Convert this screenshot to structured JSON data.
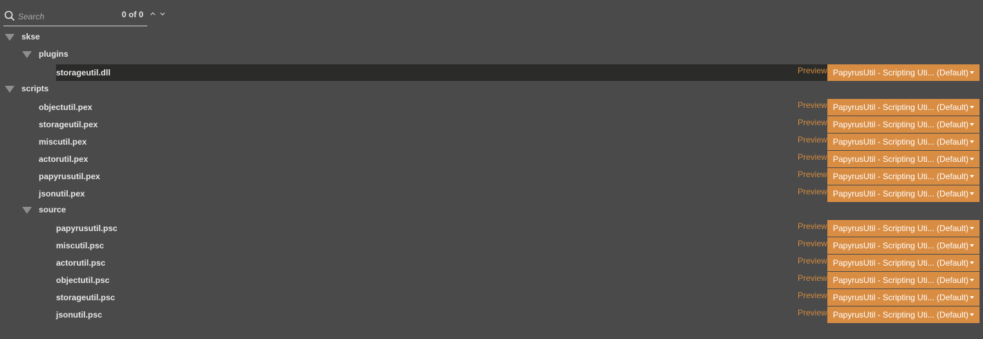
{
  "search": {
    "placeholder": "Search",
    "match_count": "0 of 0"
  },
  "tree": {
    "skse": {
      "label": "skse"
    },
    "plugins": {
      "label": "plugins"
    },
    "plugin_files": [
      {
        "name": "storageutil.dll",
        "preview": "Preview",
        "selection": "PapyrusUtil - Scripting Uti... (Default)"
      }
    ],
    "scripts": {
      "label": "scripts"
    },
    "script_files": [
      {
        "name": "objectutil.pex",
        "preview": "Preview",
        "selection": "PapyrusUtil - Scripting Uti... (Default)"
      },
      {
        "name": "storageutil.pex",
        "preview": "Preview",
        "selection": "PapyrusUtil - Scripting Uti... (Default)"
      },
      {
        "name": "miscutil.pex",
        "preview": "Preview",
        "selection": "PapyrusUtil - Scripting Uti... (Default)"
      },
      {
        "name": "actorutil.pex",
        "preview": "Preview",
        "selection": "PapyrusUtil - Scripting Uti... (Default)"
      },
      {
        "name": "papyrusutil.pex",
        "preview": "Preview",
        "selection": "PapyrusUtil - Scripting Uti... (Default)"
      },
      {
        "name": "jsonutil.pex",
        "preview": "Preview",
        "selection": "PapyrusUtil - Scripting Uti... (Default)"
      }
    ],
    "source": {
      "label": "source"
    },
    "source_files": [
      {
        "name": "papyrusutil.psc",
        "preview": "Preview",
        "selection": "PapyrusUtil - Scripting Uti... (Default)"
      },
      {
        "name": "miscutil.psc",
        "preview": "Preview",
        "selection": "PapyrusUtil - Scripting Uti... (Default)"
      },
      {
        "name": "actorutil.psc",
        "preview": "Preview",
        "selection": "PapyrusUtil - Scripting Uti... (Default)"
      },
      {
        "name": "objectutil.psc",
        "preview": "Preview",
        "selection": "PapyrusUtil - Scripting Uti... (Default)"
      },
      {
        "name": "storageutil.psc",
        "preview": "Preview",
        "selection": "PapyrusUtil - Scripting Uti... (Default)"
      },
      {
        "name": "jsonutil.psc",
        "preview": "Preview",
        "selection": "PapyrusUtil - Scripting Uti... (Default)"
      }
    ]
  },
  "colors": {
    "background": "#4a4a4a",
    "selected_row": "#2b2c2a",
    "accent": "#d98d43",
    "preview_link": "#d08a3e"
  },
  "icons": {
    "search": "search-icon",
    "prev": "chevron-up-icon",
    "next": "chevron-down-icon",
    "expand": "expanded-triangle-icon",
    "dropdown": "caret-down-icon"
  }
}
